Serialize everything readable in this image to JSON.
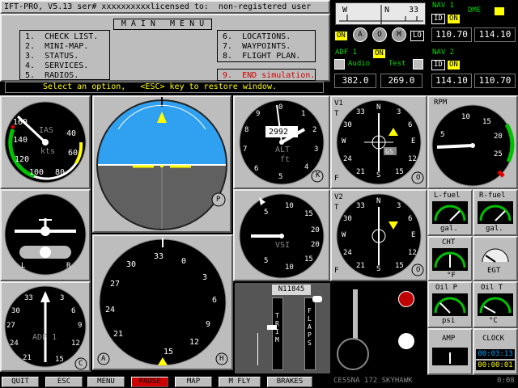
{
  "header": {
    "version": "IFT-PRO, V5.13 ser#",
    "serial": "xxxxxxxxxx",
    "license_label": "licensed to:",
    "license_user": "non-registered user"
  },
  "main_menu": {
    "title": "M A I N   M E N U",
    "left_items": [
      "1.  CHECK LIST.",
      "2.  MINI-MAP.",
      "3.  STATUS.",
      "4.  SERVICES.",
      "5.  RADIOS."
    ],
    "right_items": [
      "6.  LOCATIONS.",
      "7.  WAYPOINTS.",
      "8.  FLIGHT PLAN."
    ],
    "end_item": "9.  END simulation.",
    "status": "Select an option,   <ESC> key to restore window."
  },
  "radio": {
    "compass": {
      "w": "W",
      "n": "N",
      "n33": "33"
    },
    "marker": {
      "on": "ON",
      "a": "A",
      "o": "O",
      "m": "M",
      "lo": "LO"
    },
    "nav1": {
      "title": "NAV 1",
      "id": "ID",
      "on": "ON",
      "dme": "DME",
      "active": "110.70",
      "standby": "114.10"
    },
    "adf1": {
      "title": "ADF 1",
      "on": "ON",
      "audio": "Audio",
      "test": "Test",
      "active": "382.0",
      "standby": "269.0"
    },
    "nav2": {
      "title": "NAV 2",
      "id": "ID",
      "on": "ON",
      "active": "114.10",
      "standby": "110.70"
    }
  },
  "instruments": {
    "airspeed": {
      "label": "IAS",
      "unit": "kts",
      "ticks": [
        "160",
        "140",
        "40",
        "120",
        "60",
        "100",
        "80"
      ]
    },
    "attitude": {
      "knob": "P"
    },
    "altimeter": {
      "label": "ALT",
      "unit": "ft",
      "baro": "2992",
      "knob": "K",
      "digits": [
        "0",
        "1",
        "2",
        "3",
        "4",
        "5",
        "6",
        "7",
        "8",
        "9"
      ]
    },
    "vor1": {
      "label": "V1",
      "t": "T",
      "f": "F",
      "gs": "GS",
      "knob": "O",
      "ticks": [
        "33",
        "3",
        "30",
        "6",
        "24",
        "12",
        "21",
        "15"
      ],
      "n": "N",
      "e": "E",
      "s": "S",
      "w": "W"
    },
    "rpm": {
      "label": "RPM",
      "ticks": [
        "10",
        "15",
        "20",
        "5",
        "25"
      ]
    },
    "turn_coord": {
      "l": "L",
      "r": "R"
    },
    "vsi": {
      "label": "VSI",
      "ticks": [
        "5",
        "10",
        "15",
        "20",
        "5",
        "10",
        "15",
        "20"
      ]
    },
    "vor2": {
      "label": "V2",
      "t": "T",
      "f": "F",
      "knob": "O",
      "ticks": [
        "33",
        "3",
        "30",
        "6",
        "24",
        "12",
        "21",
        "15"
      ],
      "n": "N",
      "e": "E",
      "s": "S",
      "w": "W"
    },
    "heading": {
      "knob_left": "A",
      "knob_right": "H",
      "ticks": [
        "33",
        "0",
        "3",
        "30",
        "6",
        "27",
        "9",
        "24",
        "12",
        "21",
        "15"
      ],
      "n": "N",
      "e": "E",
      "s": "S",
      "w": "W"
    },
    "adf": {
      "label": "ADF 1",
      "knob": "C",
      "ticks": [
        "33",
        "3",
        "30",
        "6",
        "27",
        "9",
        "24",
        "12",
        "21",
        "15"
      ],
      "n": "N",
      "e": "E",
      "s": "S",
      "w": "W"
    },
    "lfuel": {
      "label": "L-fuel",
      "unit": "gal."
    },
    "rfuel": {
      "label": "R-fuel",
      "unit": "gal."
    },
    "cht": {
      "label": "CHT",
      "unit": "°F"
    },
    "egt": {
      "label": "EGT"
    },
    "oilp": {
      "label": "Oil P",
      "unit": "psi"
    },
    "oilt": {
      "label": "Oil T",
      "unit": "°C"
    },
    "amp": {
      "label": "AMP"
    },
    "clock": {
      "label": "CLOCK",
      "time1": "00:03:13",
      "time2": "00:00:01"
    },
    "tail": {
      "label": "N11845"
    },
    "trim": {
      "letters": [
        "T",
        "R",
        "I",
        "M"
      ]
    },
    "flaps": {
      "letters": [
        "F",
        "L",
        "A",
        "P",
        "S"
      ]
    }
  },
  "bottom_bar": {
    "buttons": [
      "QUIT",
      "ESC",
      "MENU",
      "PAUSE",
      "MAP",
      "M FLY",
      "BRAKES"
    ],
    "aircraft": "CESSNA 172 SKYHAWK",
    "time": "0:08"
  },
  "colors": {
    "panel": "#bdbdbd",
    "sky": "#30a0f0",
    "ground": "#606060",
    "pause": "#d00000",
    "yellow": "#ffff00",
    "green": "#00d800"
  }
}
